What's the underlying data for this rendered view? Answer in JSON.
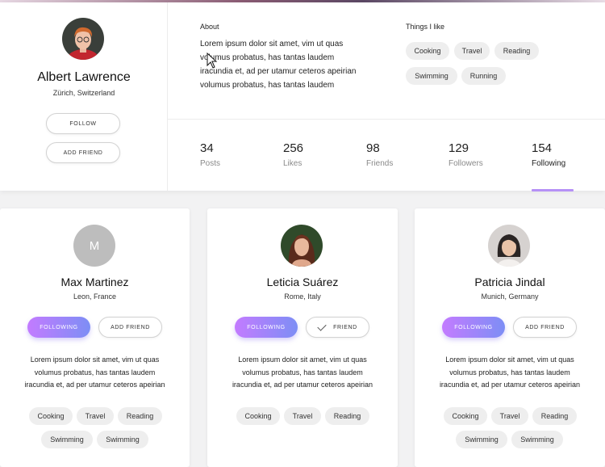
{
  "profile": {
    "name": "Albert Lawrence",
    "location": "Zürich, Switzerland",
    "follow_label": "FOLLOW",
    "add_friend_label": "ADD FRIEND",
    "about_title": "About",
    "about_lines": [
      "Lorem ipsum dolor sit amet, vim ut quas",
      "volumus probatus, has tantas laudem",
      "iracundia et, ad per utamur ceteros apeirian",
      "volumus probatus, has tantas laudem"
    ],
    "likes_title": "Things I like",
    "likes": [
      "Cooking",
      "Travel",
      "Reading",
      "Swimming",
      "Running"
    ]
  },
  "stats": [
    {
      "value": "34",
      "label": "Posts"
    },
    {
      "value": "256",
      "label": "Likes"
    },
    {
      "value": "98",
      "label": "Friends"
    },
    {
      "value": "129",
      "label": "Followers"
    },
    {
      "value": "154",
      "label": "Following"
    }
  ],
  "active_stat": "Following",
  "colors": {
    "accent_start": "#c37bff",
    "accent_end": "#7d8ef5",
    "underline": "#b691f6"
  },
  "cards": [
    {
      "initial": "M",
      "name": "Max Martinez",
      "location": "Leon, France",
      "primary_label": "FOLLOWING",
      "secondary_label": "ADD FRIEND",
      "text_lines": [
        "Lorem ipsum dolor sit amet, vim ut quas",
        "volumus probatus, has tantas laudem",
        "iracundia et, ad per utamur ceteros apeirian"
      ],
      "tags": [
        "Cooking",
        "Travel",
        "Reading",
        "Swimming",
        "Swimming"
      ]
    },
    {
      "name": "Leticia Suárez",
      "location": "Rome, Italy",
      "primary_label": "FOLLOWING",
      "secondary_label": "FRIEND",
      "text_lines": [
        "Lorem ipsum dolor sit amet, vim ut quas",
        "volumus probatus, has tantas laudem",
        "iracundia et, ad per utamur ceteros apeirian"
      ],
      "tags": [
        "Cooking",
        "Travel",
        "Reading"
      ]
    },
    {
      "name": "Patricia Jindal",
      "location": "Munich, Germany",
      "primary_label": "FOLLOWING",
      "secondary_label": "ADD FRIEND",
      "text_lines": [
        "Lorem ipsum dolor sit amet, vim ut quas",
        "volumus probatus, has tantas laudem",
        "iracundia et, ad per utamur ceteros apeirian"
      ],
      "tags": [
        "Cooking",
        "Travel",
        "Reading",
        "Swimming",
        "Swimming"
      ]
    }
  ]
}
